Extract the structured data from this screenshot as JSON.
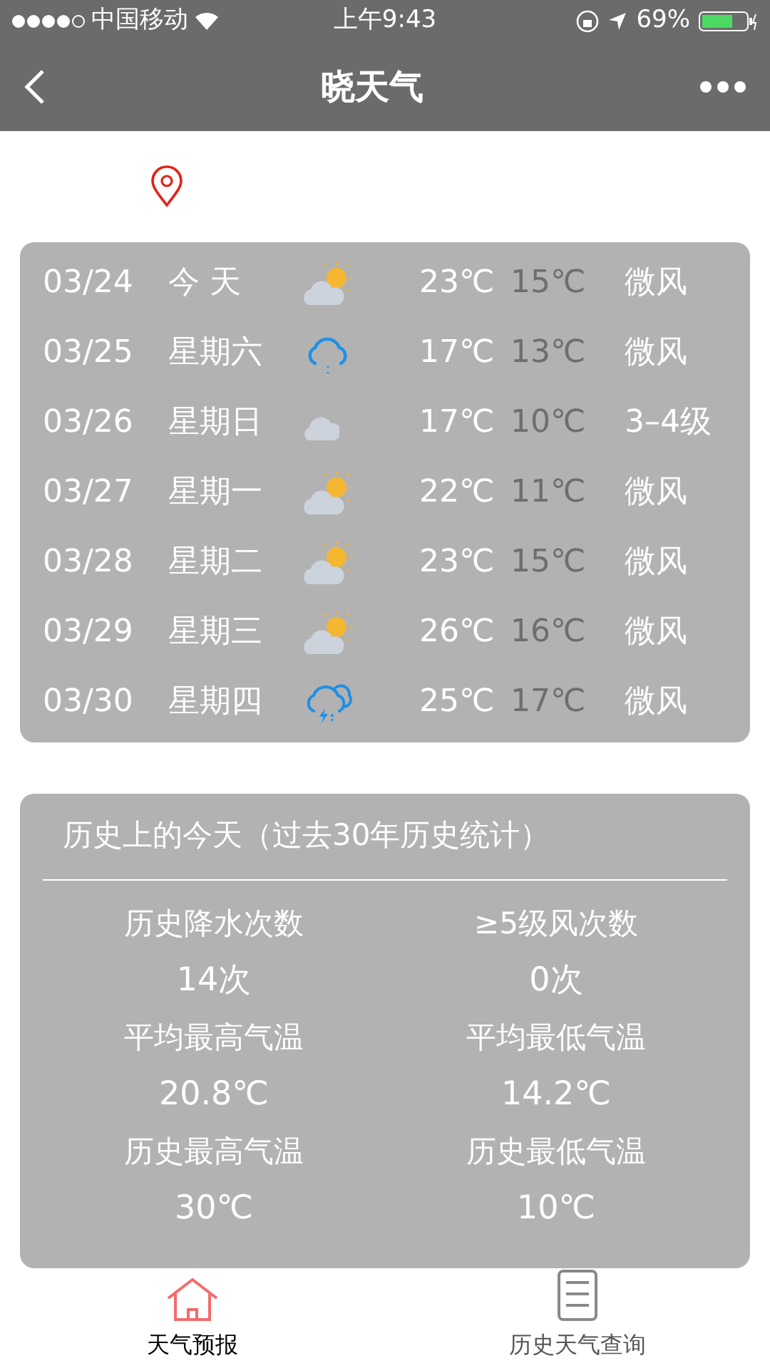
{
  "status_bar": {
    "carrier": "中国移动",
    "time": "上午9:43",
    "battery_text": "69%"
  },
  "nav": {
    "title": "晓天气"
  },
  "forecast": [
    {
      "date": "03/24",
      "day": "今 天",
      "kind": "partly_sunny",
      "high": "23℃",
      "low": "15℃",
      "wind": "微风"
    },
    {
      "date": "03/25",
      "day": "星期六",
      "kind": "rain",
      "high": "17℃",
      "low": "13℃",
      "wind": "微风"
    },
    {
      "date": "03/26",
      "day": "星期日",
      "kind": "cloudy",
      "high": "17℃",
      "low": "10℃",
      "wind": "3–4级"
    },
    {
      "date": "03/27",
      "day": "星期一",
      "kind": "partly_sunny",
      "high": "22℃",
      "low": "11℃",
      "wind": "微风"
    },
    {
      "date": "03/28",
      "day": "星期二",
      "kind": "partly_sunny",
      "high": "23℃",
      "low": "15℃",
      "wind": "微风"
    },
    {
      "date": "03/29",
      "day": "星期三",
      "kind": "partly_sunny",
      "high": "26℃",
      "low": "16℃",
      "wind": "微风"
    },
    {
      "date": "03/30",
      "day": "星期四",
      "kind": "thunder_rain",
      "high": "25℃",
      "low": "17℃",
      "wind": "微风"
    }
  ],
  "history": {
    "title": "历史上的今天（过去30年历史统计）",
    "stats": [
      {
        "label": "历史降水次数",
        "value": "14次"
      },
      {
        "label": "≥5级风次数",
        "value": "0次"
      },
      {
        "label": "平均最高气温",
        "value": "20.8℃"
      },
      {
        "label": "平均最低气温",
        "value": "14.2℃"
      },
      {
        "label": "历史最高气温",
        "value": "30℃"
      },
      {
        "label": "历史最低气温",
        "value": "10℃"
      }
    ]
  },
  "tab_bar": [
    {
      "label": "天气预报",
      "kind": "home",
      "selected": true
    },
    {
      "label": "历史天气查询",
      "kind": "list",
      "selected": false
    }
  ]
}
